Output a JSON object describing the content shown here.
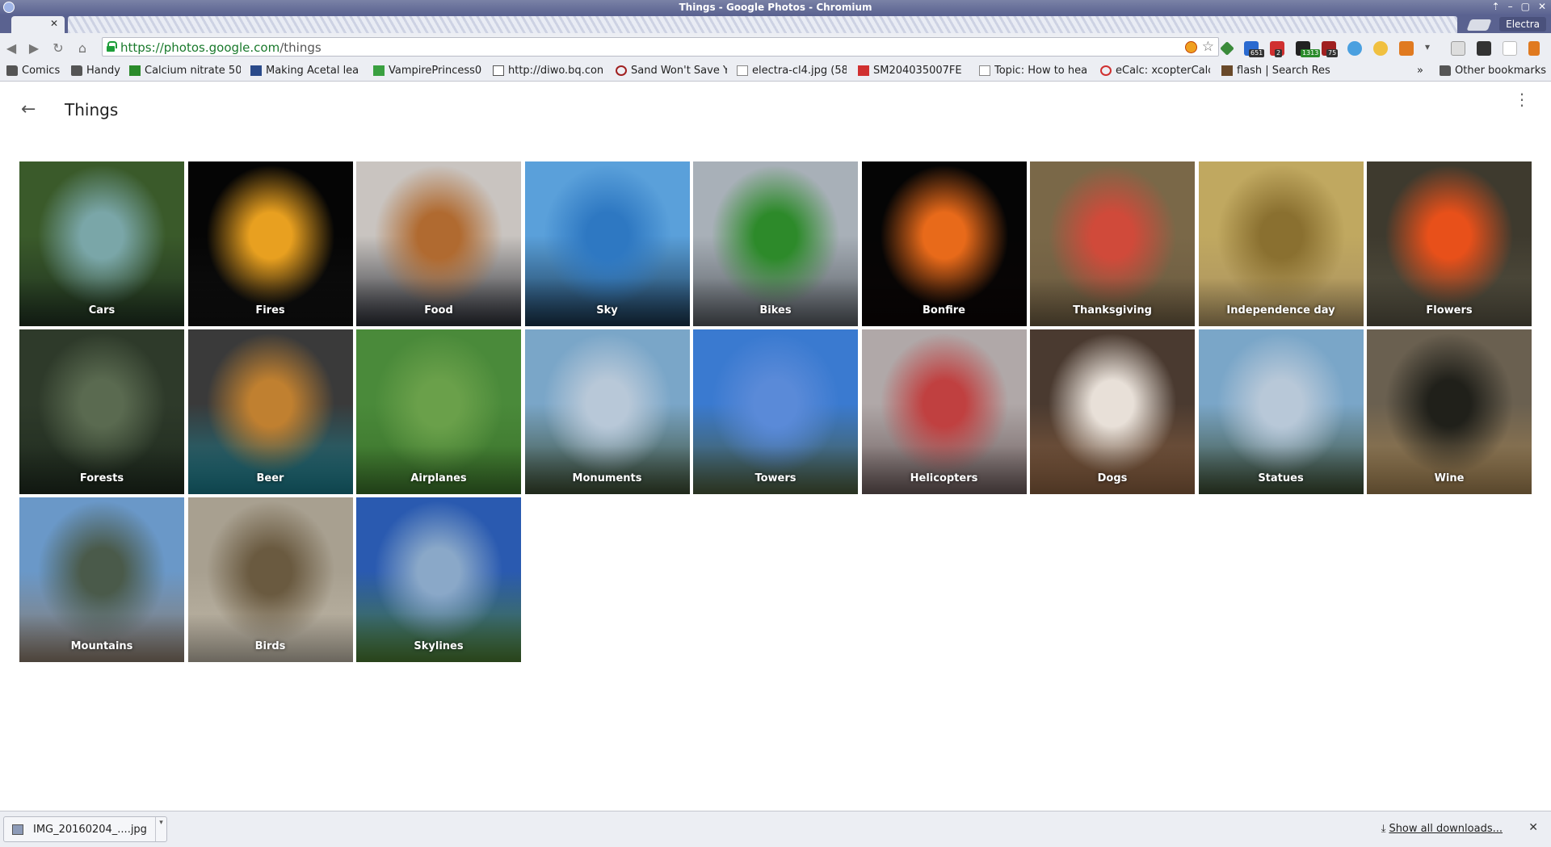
{
  "window": {
    "title": "Things - Google Photos - Chromium",
    "profile": "Electra"
  },
  "controls": {
    "close": "✕",
    "minimize": "–",
    "maximize": "▢",
    "up": "⇡"
  },
  "address": {
    "scheme_host": "https://photos.google.com",
    "path": "/things"
  },
  "bookmarks": [
    {
      "label": "Comics",
      "icon": "folder-icon"
    },
    {
      "label": "Handy",
      "icon": "folder-icon"
    },
    {
      "label": "Calcium nitrate 50",
      "icon": "page-icon"
    },
    {
      "label": "Making Acetal lea",
      "icon": "page-icon"
    },
    {
      "label": "VampirePrincess0",
      "icon": "page-icon"
    },
    {
      "label": "http://diwo.bq.con",
      "icon": "page-icon"
    },
    {
      "label": "Sand Won't Save Y",
      "icon": "page-icon"
    },
    {
      "label": "electra-cl4.jpg (58",
      "icon": "page-icon"
    },
    {
      "label": "SM204035007FE",
      "icon": "page-icon"
    },
    {
      "label": "Topic: How to hea",
      "icon": "page-icon"
    },
    {
      "label": "eCalc: xcopterCalc",
      "icon": "page-icon"
    },
    {
      "label": "flash | Search Res",
      "icon": "page-icon"
    }
  ],
  "bookmarks_more": "»",
  "other_bookmarks": "Other bookmarks",
  "extensions": {
    "badges": [
      "651",
      "2",
      "1313",
      "75"
    ]
  },
  "page": {
    "title": "Things",
    "back_icon": "←",
    "more_icon": "⋮"
  },
  "tiles": [
    {
      "label": "Cars",
      "colors": [
        "#3a5a2a",
        "#7aa6a8",
        "#1e3020"
      ]
    },
    {
      "label": "Fires",
      "colors": [
        "#050505",
        "#e8a020",
        "#101010"
      ]
    },
    {
      "label": "Food",
      "colors": [
        "#c9c4c0",
        "#b06a30",
        "#2b2e36"
      ]
    },
    {
      "label": "Sky",
      "colors": [
        "#5aa0da",
        "#2e78c2",
        "#18334a"
      ]
    },
    {
      "label": "Bikes",
      "colors": [
        "#a8b0b8",
        "#2d8a2a",
        "#555a60"
      ]
    },
    {
      "label": "Bonfire",
      "colors": [
        "#050505",
        "#e86a1a",
        "#0a0505"
      ]
    },
    {
      "label": "Thanksgiving",
      "colors": [
        "#7a6848",
        "#d04a3a",
        "#6a5a40"
      ]
    },
    {
      "label": "Independence day",
      "colors": [
        "#c0a860",
        "#8a7030",
        "#a89060"
      ]
    },
    {
      "label": "Flowers",
      "colors": [
        "#3e3a2e",
        "#e8501a",
        "#565242"
      ]
    },
    {
      "label": "Forests",
      "colors": [
        "#2e3a2a",
        "#5a6a50",
        "#1e2a1e"
      ]
    },
    {
      "label": "Beer",
      "colors": [
        "#3a3a3a",
        "#c08030",
        "#1a7a8a"
      ]
    },
    {
      "label": "Airplanes",
      "colors": [
        "#4a8a3a",
        "#6aa04a",
        "#3a702a"
      ]
    },
    {
      "label": "Monuments",
      "colors": [
        "#7aa6c8",
        "#b8c8d8",
        "#3a4a30"
      ]
    },
    {
      "label": "Towers",
      "colors": [
        "#3a7ad0",
        "#5a8ad8",
        "#4a5a3a"
      ]
    },
    {
      "label": "Helicopters",
      "colors": [
        "#b0a8a8",
        "#c04040",
        "#6a5a5a"
      ]
    },
    {
      "label": "Dogs",
      "colors": [
        "#4a3a30",
        "#e8e0d8",
        "#8a6040"
      ]
    },
    {
      "label": "Statues",
      "colors": [
        "#7aa6c8",
        "#b8c8d8",
        "#3a4a30"
      ]
    },
    {
      "label": "Wine",
      "colors": [
        "#6a6050",
        "#20201a",
        "#a08050"
      ]
    },
    {
      "label": "Mountains",
      "colors": [
        "#6a98c8",
        "#4a5a4a",
        "#8a7a6a"
      ]
    },
    {
      "label": "Birds",
      "colors": [
        "#a8a090",
        "#6a5a40",
        "#c0b8a8"
      ]
    },
    {
      "label": "Skylines",
      "colors": [
        "#2a5ab0",
        "#8aa8c8",
        "#4a7a30"
      ]
    }
  ],
  "downloads": {
    "file": "IMG_20160204_....jpg",
    "show_all": "Show all downloads...",
    "close": "✕"
  }
}
